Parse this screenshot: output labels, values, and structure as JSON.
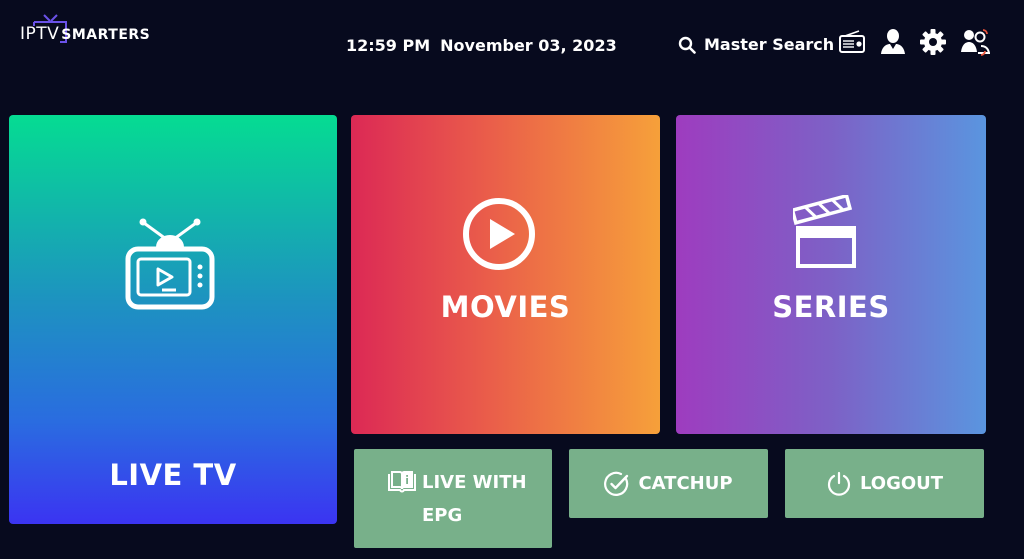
{
  "header": {
    "logo_left": "IPTV",
    "logo_right": "SMARTERS",
    "time": "12:59 PM",
    "date": "November 03, 2023",
    "search_label": "Master Search",
    "icons": [
      "radio-icon",
      "profile-icon",
      "settings-icon",
      "switch-user-icon"
    ]
  },
  "tiles": {
    "live_tv": "LIVE TV",
    "movies": "MOVIES",
    "series": "SERIES"
  },
  "buttons": {
    "epg_line1": "LIVE WITH",
    "epg_line2": "EPG",
    "catchup": "CATCHUP",
    "logout": "LOGOUT"
  },
  "colors": {
    "background": "#070a1e",
    "button_green": "#78b08a",
    "live_tv_top": "#05dc92",
    "live_tv_bottom": "#3b34f2",
    "movies_left": "#dc2955",
    "movies_right": "#f6a03a",
    "series_left": "#9e3cbf",
    "series_right": "#5a95df"
  }
}
